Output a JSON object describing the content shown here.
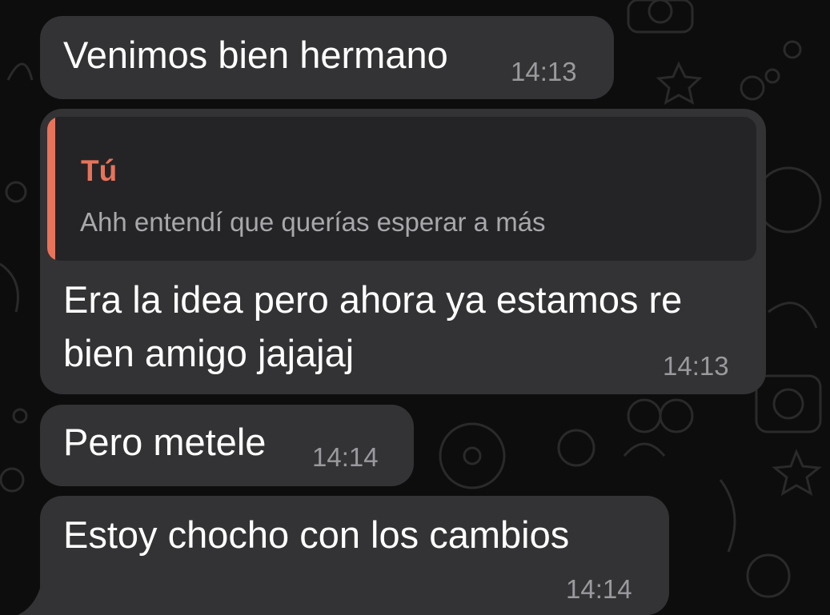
{
  "colors": {
    "background": "#0d0d0d",
    "bubble": "#333335",
    "quote_background": "#242426",
    "quote_accent": "#e8735a",
    "text": "#ffffff",
    "timestamp": "#9a9a9e"
  },
  "messages": [
    {
      "text": "Venimos bien hermano",
      "time": "14:13"
    },
    {
      "reply_to": {
        "author": "Tú",
        "text": "Ahh entendí que querías esperar a más"
      },
      "lines": [
        "Era la idea pero ahora ya estamos re",
        "bien amigo jajajaj"
      ],
      "time": "14:13"
    },
    {
      "text": "Pero metele",
      "time": "14:14"
    },
    {
      "text": "Estoy chocho con los cambios",
      "time": "14:14"
    }
  ]
}
